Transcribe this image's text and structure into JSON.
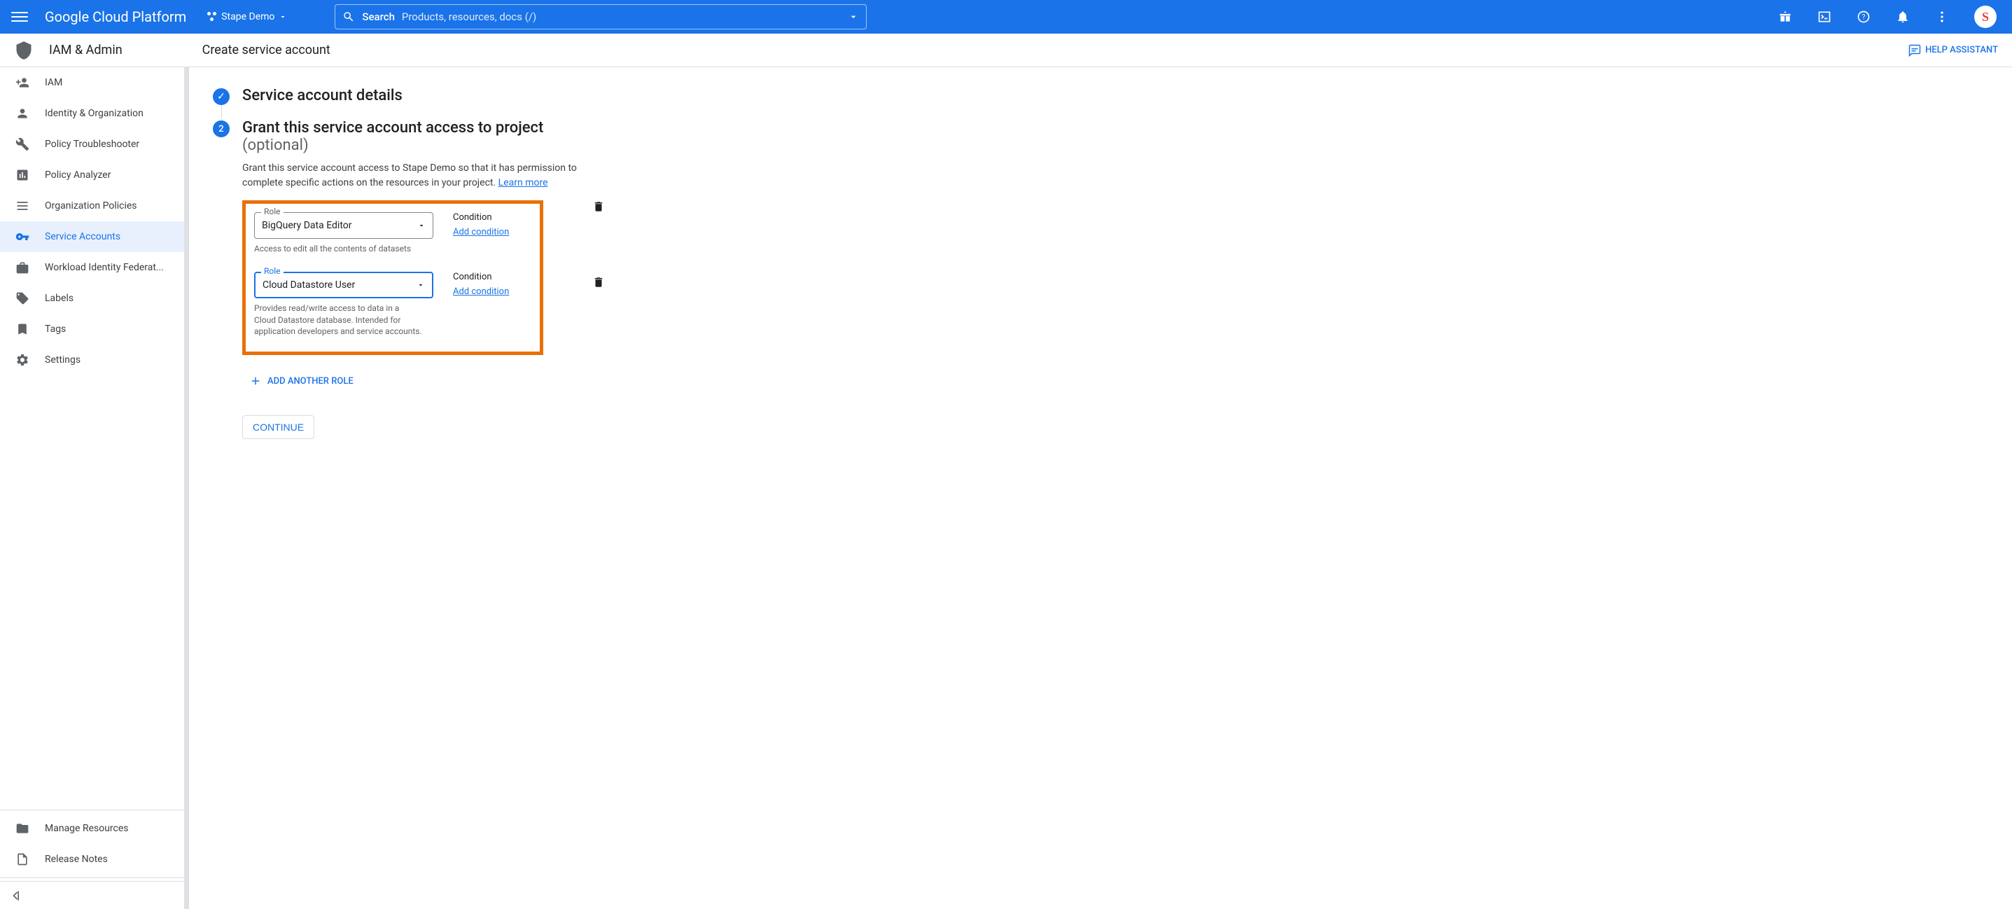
{
  "header": {
    "product": "Google Cloud Platform",
    "project": "Stape Demo",
    "search_label": "Search",
    "search_placeholder": "Products, resources, docs (/)",
    "avatar_letter": "S"
  },
  "subheader": {
    "section": "IAM & Admin",
    "page_title": "Create service account",
    "help": "HELP ASSISTANT"
  },
  "sidebar": {
    "items": [
      {
        "label": "IAM"
      },
      {
        "label": "Identity & Organization"
      },
      {
        "label": "Policy Troubleshooter"
      },
      {
        "label": "Policy Analyzer"
      },
      {
        "label": "Organization Policies"
      },
      {
        "label": "Service Accounts"
      },
      {
        "label": "Workload Identity Federat..."
      },
      {
        "label": "Labels"
      },
      {
        "label": "Tags"
      },
      {
        "label": "Settings"
      }
    ],
    "bottom": [
      {
        "label": "Manage Resources"
      },
      {
        "label": "Release Notes"
      }
    ]
  },
  "steps": {
    "s1_title": "Service account details",
    "s2_title": "Grant this service account access to project",
    "s2_subtitle": "(optional)",
    "s2_desc": "Grant this service account access to Stape Demo so that it has permission to complete specific actions on the resources in your project.",
    "learn_more": "Learn more"
  },
  "roles": [
    {
      "label": "Role",
      "value": "BigQuery Data Editor",
      "help": "Access to edit all the contents of datasets",
      "condition_label": "Condition",
      "add_condition": "Add condition"
    },
    {
      "label": "Role",
      "value": "Cloud Datastore User",
      "help": "Provides read/write access to data in a Cloud Datastore database. Intended for application developers and service accounts.",
      "condition_label": "Condition",
      "add_condition": "Add condition"
    }
  ],
  "buttons": {
    "add_role": "ADD ANOTHER ROLE",
    "continue": "CONTINUE"
  }
}
